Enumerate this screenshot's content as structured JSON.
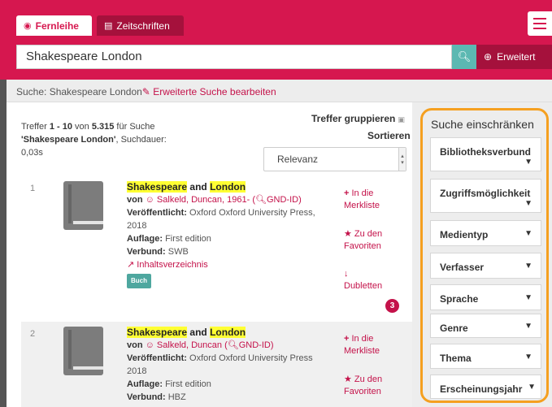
{
  "header": {
    "tabs": [
      {
        "icon": "globe-icon",
        "label": "Fernleihe"
      },
      {
        "icon": "newspaper-icon",
        "label": "Zeitschriften"
      }
    ],
    "search_value": "Shakespeare London",
    "advanced_label": "Erweitert",
    "colors": {
      "brand": "#d6174f",
      "brand_dark": "#a5113c",
      "teal": "#5cb8b2"
    }
  },
  "breadcrumb": {
    "prefix": "Suche: Shakespeare London",
    "edit_label": "Erweiterte Suche bearbeiten"
  },
  "summary": {
    "prefix": "Treffer ",
    "range": "1 - 10",
    "of": " von ",
    "total": "5.315",
    "for": " für Suche",
    "query": "'Shakespeare London'",
    "duration_label": ", Suchdauer:",
    "duration": "0,03s"
  },
  "controls": {
    "group_label": "Treffer gruppieren",
    "sort_label": "Sortieren",
    "sort_value": "Relevanz"
  },
  "results": [
    {
      "number": "1",
      "title_a": "Shakespeare",
      "title_and": "and",
      "title_b": "London",
      "by": "von",
      "author": "Salkeld, Duncan, 1961-",
      "gnd": "GND-ID",
      "published_label": "Veröffentlicht:",
      "published": "Oxford Oxford University Press, 2018",
      "edition_label": "Auflage:",
      "edition": "First edition",
      "network_label": "Verbund:",
      "network": "SWB",
      "toc": "Inhaltsverzeichnis",
      "type_badge": "Buch",
      "action_merkliste": "In die Merkliste",
      "action_favoriten": "Zu den Favoriten",
      "action_dubletten": "Dubletten",
      "dubletten_count": "3"
    },
    {
      "number": "2",
      "title_a": "Shakespeare",
      "title_and": "and",
      "title_b": "London",
      "by": "von",
      "author": "Salkeld, Duncan",
      "gnd": "GND-ID",
      "published_label": "Veröffentlicht:",
      "published": "Oxford Oxford University Press 2018",
      "edition_label": "Auflage:",
      "edition": "First edition",
      "network_label": "Verbund:",
      "network": "HBZ",
      "action_merkliste": "In die Merkliste",
      "action_favoriten": "Zu den Favoriten"
    }
  ],
  "sidebar": {
    "title": "Suche einschränken",
    "facets": [
      "Bibliotheksverbund",
      "Zugriffsmöglichkeit",
      "Medientyp",
      "Verfasser",
      "Sprache",
      "Genre",
      "Thema",
      "Erscheinungsjahr"
    ],
    "highlight_color": "#f5a020"
  }
}
